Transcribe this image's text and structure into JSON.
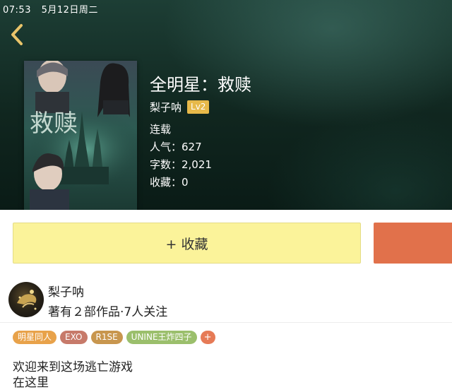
{
  "status_bar": {
    "time": "07:53",
    "date": "5月12日周二"
  },
  "book": {
    "title": "全明星：救赎",
    "author": "梨子呐",
    "level": "Lv2",
    "status": "连载",
    "popularity": "人气：627",
    "word_count": "字数：2,021",
    "favorites": "收藏：0",
    "cover_text": "救赎"
  },
  "actions": {
    "collect_label": "+ 收藏"
  },
  "author_section": {
    "name": "梨子呐",
    "stats": "著有２部作品·7人关注"
  },
  "tags": [
    {
      "label": "明星同人",
      "color": "#e8a24a"
    },
    {
      "label": "EXO",
      "color": "#c77a6a"
    },
    {
      "label": "R1SE",
      "color": "#c8964e"
    },
    {
      "label": "UNINE王炸四子",
      "color": "#9bbf6c"
    }
  ],
  "tag_add_label": "+",
  "tag_add_color": "#e67a56",
  "intro": [
    "欢迎来到这场逃亡游戏",
    "在这里"
  ],
  "colors": {
    "header_bg": "#10261f",
    "back_arrow": "#e9c46a",
    "level_badge": "#e7b94a",
    "collect_button": "#fbf39a",
    "read_button": "#e1714b"
  },
  "icons": {
    "back": "chevron-left-icon"
  }
}
